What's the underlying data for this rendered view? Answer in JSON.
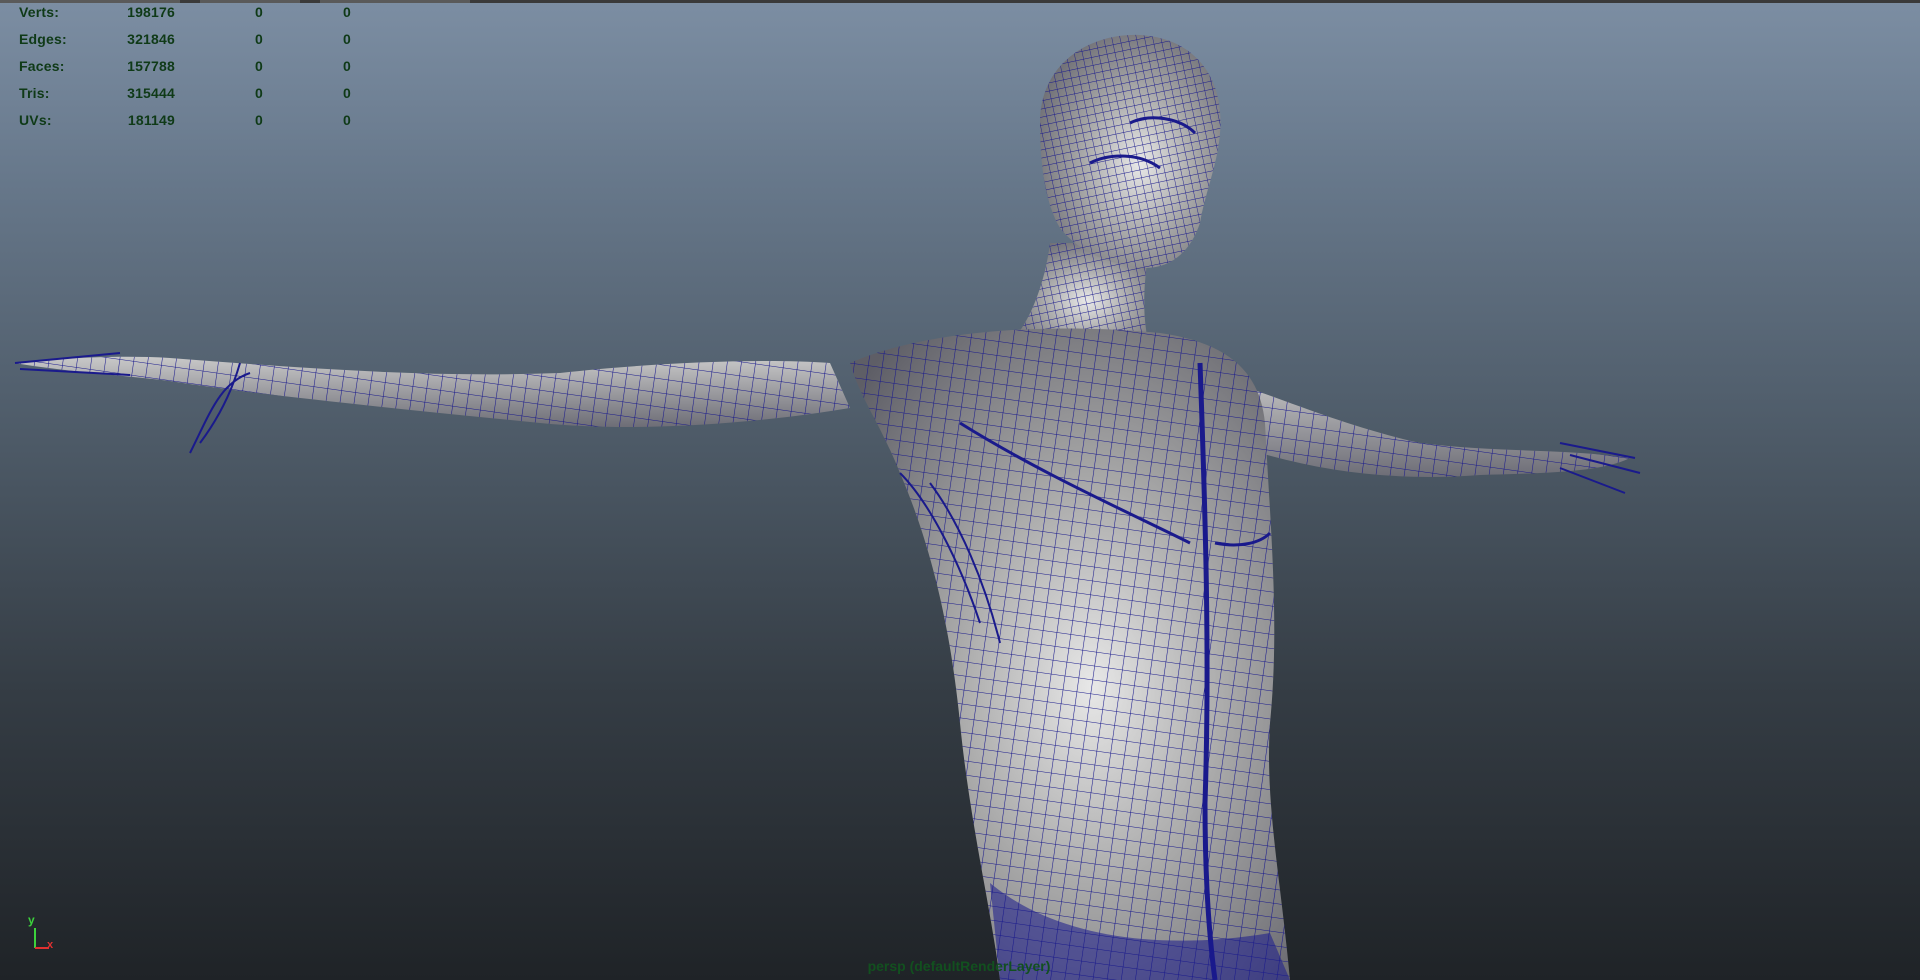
{
  "hud": {
    "rows": [
      {
        "label": "Verts:",
        "total": "198176",
        "selected": "0",
        "selected2": "0"
      },
      {
        "label": "Edges:",
        "total": "321846",
        "selected": "0",
        "selected2": "0"
      },
      {
        "label": "Faces:",
        "total": "157788",
        "selected": "0",
        "selected2": "0"
      },
      {
        "label": "Tris:",
        "total": "315444",
        "selected": "0",
        "selected2": "0"
      },
      {
        "label": "UVs:",
        "total": "181149",
        "selected": "0",
        "selected2": "0"
      }
    ]
  },
  "viewport": {
    "camera_label": "persp (defaultRenderLayer)",
    "wire_color": "#1a1a8c",
    "surface_color": "#9a9a9a"
  },
  "axes": {
    "y_label": "y",
    "x_label": "x",
    "y_color": "#3cd23c",
    "x_color": "#e03030"
  }
}
